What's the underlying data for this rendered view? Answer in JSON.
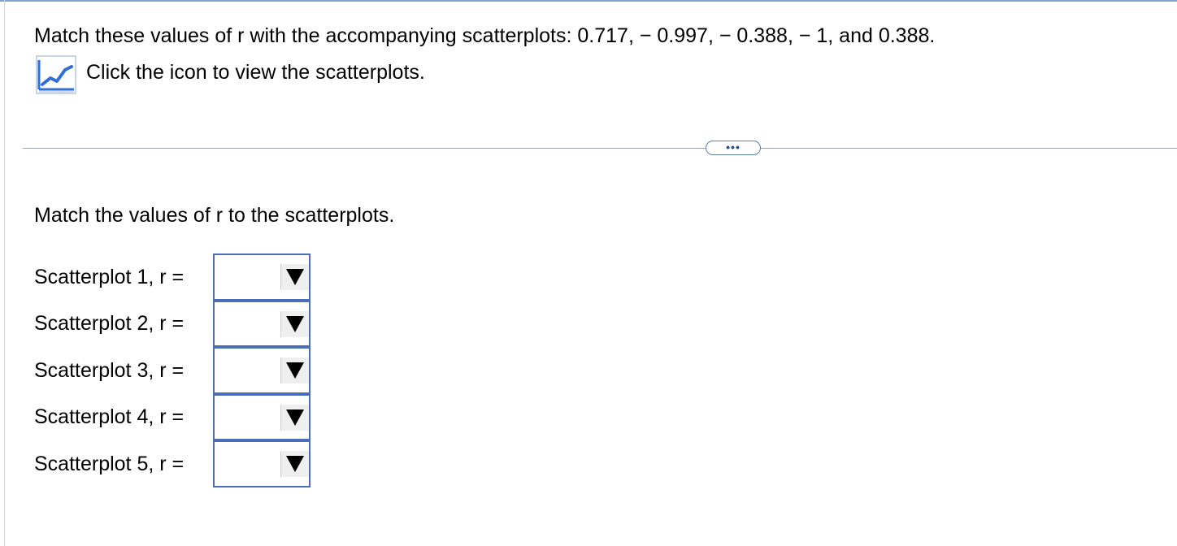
{
  "question": {
    "text": "Match these values of r with the accompanying scatterplots: 0.717,  − 0.997,  − 0.388,  − 1, and 0.388."
  },
  "icon_link": {
    "icon": "chart-icon",
    "label": "Click the icon to view the scatterplots."
  },
  "divider": {
    "more_label": "•••"
  },
  "instruction": "Match the values of r to the scatterplots.",
  "rows": [
    {
      "label": "Scatterplot 1, r =",
      "value": ""
    },
    {
      "label": "Scatterplot 2, r =",
      "value": ""
    },
    {
      "label": "Scatterplot 3, r =",
      "value": ""
    },
    {
      "label": "Scatterplot 4, r =",
      "value": ""
    },
    {
      "label": "Scatterplot 5, r =",
      "value": ""
    }
  ],
  "colors": {
    "accent_blue": "#4a6fb8",
    "icon_blue": "#2f6fd6"
  }
}
